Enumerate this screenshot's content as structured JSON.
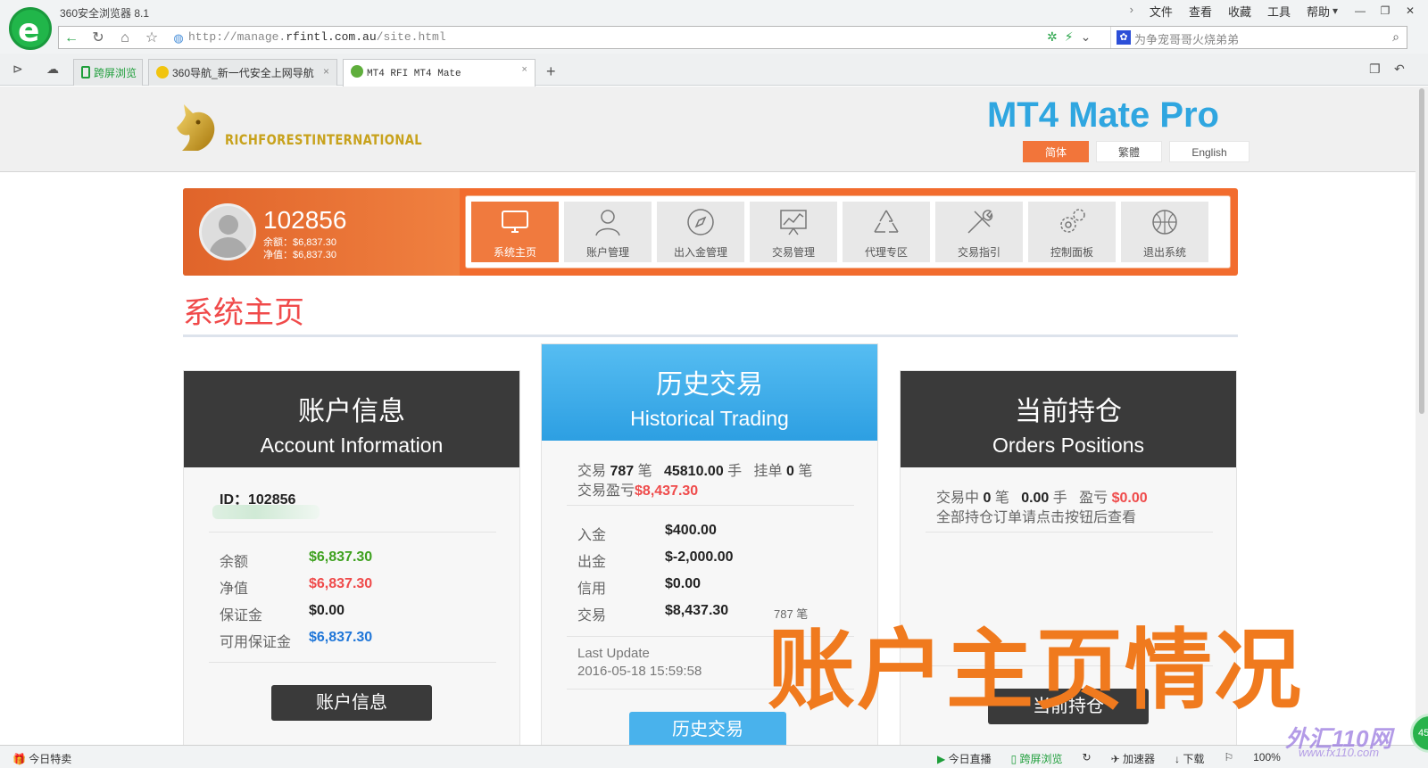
{
  "browser": {
    "title": "360安全浏览器 8.1",
    "menu": [
      "文件",
      "查看",
      "收藏",
      "工具",
      "帮助"
    ],
    "url_prefix": "http://manage.",
    "url_host": "rfintl.com.au",
    "url_path": "/site.html",
    "search_text": "为争宠哥哥火烧弟弟",
    "tabs": [
      {
        "label": "跨屏浏览"
      },
      {
        "label": "360导航_新一代安全上网导航"
      },
      {
        "label": "MT4 RFI MT4 Mate"
      }
    ]
  },
  "header": {
    "brand": "RICHFORESTINTERNATIONAL",
    "app_title": "MT4 Mate Pro",
    "languages": [
      "简体",
      "繁體",
      "English"
    ]
  },
  "user": {
    "account_no": "102856",
    "balance_line": "余额：$6,837.30",
    "equity_line": "净值：$6,837.30"
  },
  "nav": [
    {
      "label": "系统主页",
      "icon": "monitor-icon",
      "active": true
    },
    {
      "label": "账户管理",
      "icon": "user-icon"
    },
    {
      "label": "出入金管理",
      "icon": "compass-icon"
    },
    {
      "label": "交易管理",
      "icon": "chart-icon"
    },
    {
      "label": "代理专区",
      "icon": "recycle-icon"
    },
    {
      "label": "交易指引",
      "icon": "tools-icon"
    },
    {
      "label": "控制面板",
      "icon": "gears-icon"
    },
    {
      "label": "退出系统",
      "icon": "basketball-icon"
    }
  ],
  "page_heading": "系统主页",
  "account_card": {
    "title_zh": "账户信息",
    "title_en": "Account Information",
    "id_line": "ID：102856",
    "rows": [
      {
        "label": "余额",
        "value": "$6,837.30"
      },
      {
        "label": "净值",
        "value": "$6,837.30"
      },
      {
        "label": "保证金",
        "value": "$0.00"
      },
      {
        "label": "可用保证金",
        "value": "$6,837.30"
      }
    ],
    "button": "账户信息"
  },
  "history_card": {
    "title_zh": "历史交易",
    "title_en": "Historical Trading",
    "line1": {
      "trade_label": "交易",
      "trade_count": "787",
      "trade_unit": "笔",
      "lots": "45810.00",
      "lots_unit": "手",
      "pending_label": "挂单",
      "pending_count": "0",
      "pending_unit": "笔"
    },
    "pnl_label": "交易盈亏",
    "pnl_value": "$8,437.30",
    "rows": [
      {
        "label": "入金",
        "value": "$400.00"
      },
      {
        "label": "出金",
        "value": "$-2,000.00"
      },
      {
        "label": "信用",
        "value": "$0.00"
      },
      {
        "label": "交易",
        "value": "$8,437.30",
        "extra": "787 笔"
      }
    ],
    "last_update_label": "Last Update",
    "last_update_value": "2016-05-18 15:59:58",
    "button": "历史交易"
  },
  "positions_card": {
    "title_zh": "当前持仓",
    "title_en": "Orders Positions",
    "line1": {
      "trading_label": "交易中",
      "trading_count": "0",
      "trading_unit": "笔",
      "lots": "0.00",
      "lots_unit": "手",
      "pnl_label": "盈亏",
      "pnl_value": "$0.00"
    },
    "note": "全部持仓订单请点击按钮后查看",
    "button": "当前持仓"
  },
  "overlay_caption": "账户主页情况",
  "statusbar": {
    "left": "今日特卖",
    "right": [
      "今日直播",
      "跨屏浏览",
      "加速器",
      "下载"
    ],
    "zoom": "100%"
  },
  "fx_watermark": "外汇110网",
  "fx_watermark_url": "www.fx110.com",
  "float_badge": "45",
  "colors": {
    "accent_orange": "#f26c2e",
    "title_blue": "#2fa6e0",
    "positive_green": "#3ea11f",
    "negative_red": "#ef4b4b"
  }
}
